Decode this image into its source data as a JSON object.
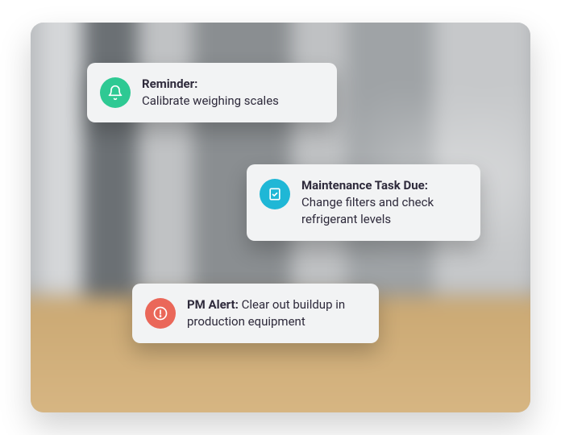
{
  "cards": [
    {
      "icon": "bell-icon",
      "iconColor": "#2ec993",
      "title": "Reminder:",
      "body": "Calibrate weighing scales",
      "inline": false
    },
    {
      "icon": "clipboard-check-icon",
      "iconColor": "#1fb7d6",
      "title": "Maintenance Task Due:",
      "body": "Change filters and check refrigerant levels",
      "inline": false
    },
    {
      "icon": "alert-circle-icon",
      "iconColor": "#ea6759",
      "title": "PM Alert:",
      "body": "Clear out buildup in production equipment",
      "inline": true
    }
  ]
}
